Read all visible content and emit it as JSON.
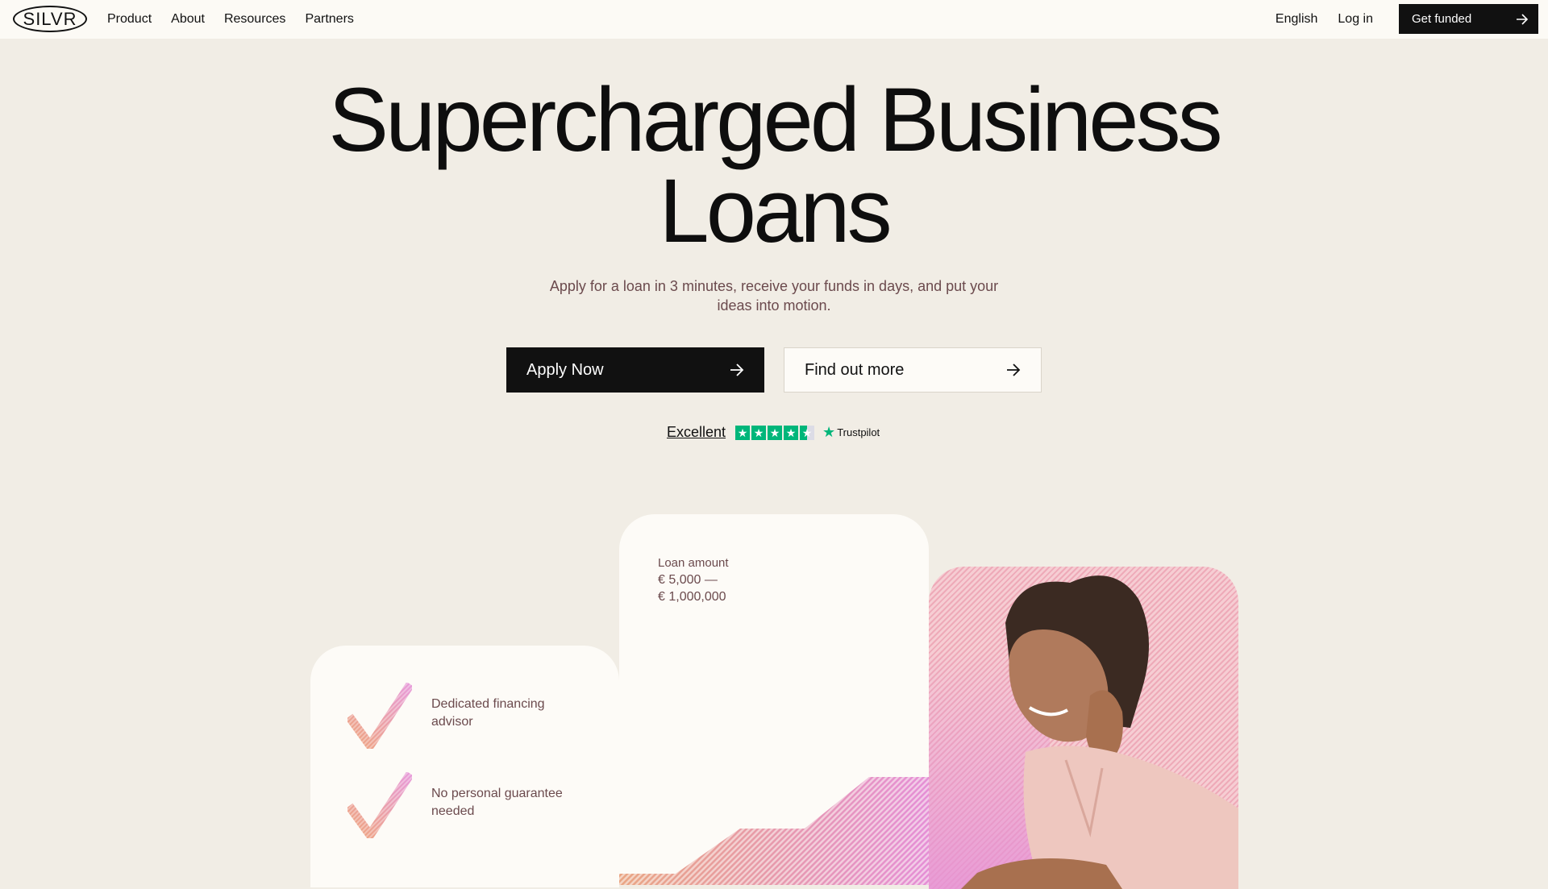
{
  "nav": {
    "logo": "SILVR",
    "links": [
      "Product",
      "About",
      "Resources",
      "Partners"
    ],
    "language": "English",
    "login": "Log in",
    "cta": "Get funded"
  },
  "hero": {
    "title_line1": "Supercharged Business",
    "title_line2": "Loans",
    "subtitle": "Apply for a loan in 3 minutes, receive your funds in days,  and put your ideas into motion.",
    "apply_button": "Apply Now",
    "more_button": "Find out more"
  },
  "trustpilot": {
    "rating_text": "Excellent",
    "brand": "Trustpilot",
    "stars": 4.5
  },
  "features": [
    {
      "text": "Dedicated financing advisor"
    },
    {
      "text": "No personal guarantee needed"
    }
  ],
  "loan": {
    "label": "Loan amount",
    "range_min": "€ 5,000 —",
    "range_max": "€ 1,000,000"
  },
  "colors": {
    "background": "#f1ede5",
    "card": "#fdfbf7",
    "dark": "#111111",
    "muted_text": "#6b4a4d",
    "accent_pink": "#e58fd6",
    "accent_orange": "#eca07a",
    "trustpilot_green": "#00b67a"
  },
  "icons": {
    "arrow": "arrow-right-icon",
    "check": "check-icon",
    "star": "star-icon"
  }
}
